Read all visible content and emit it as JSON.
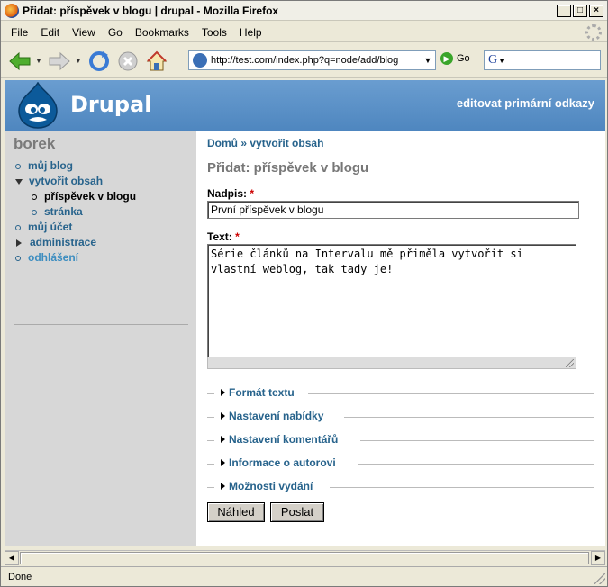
{
  "window": {
    "title": "Přidat: příspěvek v blogu | drupal - Mozilla Firefox",
    "minimize": "_",
    "maximize": "□",
    "close": "×"
  },
  "menubar": {
    "items": [
      "File",
      "Edit",
      "View",
      "Go",
      "Bookmarks",
      "Tools",
      "Help"
    ]
  },
  "navbar": {
    "url": "http://test.com/index.php?q=node/add/blog",
    "go_label": "Go",
    "search_engine_glyph": "G"
  },
  "site": {
    "name": "Drupal",
    "primary_links_edit": "editovat primární odkazy"
  },
  "sidebar": {
    "username": "borek",
    "items": [
      {
        "label": "můj blog"
      },
      {
        "label": "vytvořit obsah"
      },
      {
        "label": "příspěvek v blogu"
      },
      {
        "label": "stránka"
      },
      {
        "label": "můj účet"
      },
      {
        "label": "administrace"
      },
      {
        "label": "odhlášení"
      }
    ]
  },
  "main": {
    "breadcrumb_home": "Domů",
    "breadcrumb_sep": "»",
    "breadcrumb_current": "vytvořit obsah",
    "page_title": "Přidat: příspěvek v blogu",
    "title_label": "Nadpis:",
    "required_mark": "*",
    "title_value": "První příspěvek v blogu",
    "body_label": "Text:",
    "body_value": "Série článků na Intervalu mě přiměla vytvořit si vlastní weblog, tak tady je!",
    "fieldsets": [
      {
        "label": "Formát textu"
      },
      {
        "label": "Nastavení nabídky"
      },
      {
        "label": "Nastavení komentářů"
      },
      {
        "label": "Informace o autorovi"
      },
      {
        "label": "Možnosti vydání"
      }
    ],
    "preview_button": "Náhled",
    "submit_button": "Poslat"
  },
  "status": {
    "text": "Done"
  }
}
